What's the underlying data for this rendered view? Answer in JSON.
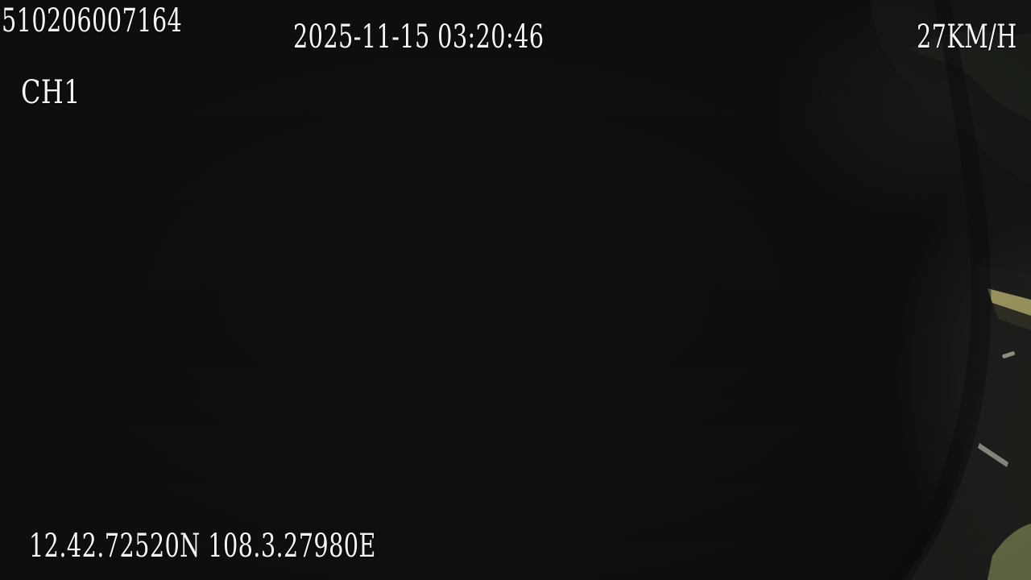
{
  "overlay": {
    "device_id": "510206007164",
    "datetime": "2025-11-15 03:20:46",
    "speed": "27KM/H",
    "channel": "CH1",
    "gps": "12.42.72520N 108.3.27980E"
  },
  "scene": {
    "description_colors": {
      "background": "#0e0e0f",
      "foliage": "#2f3328",
      "guardrail": "#c9c27a",
      "road_marking": "#c8c8b8",
      "grass": "#9aa86a"
    }
  }
}
